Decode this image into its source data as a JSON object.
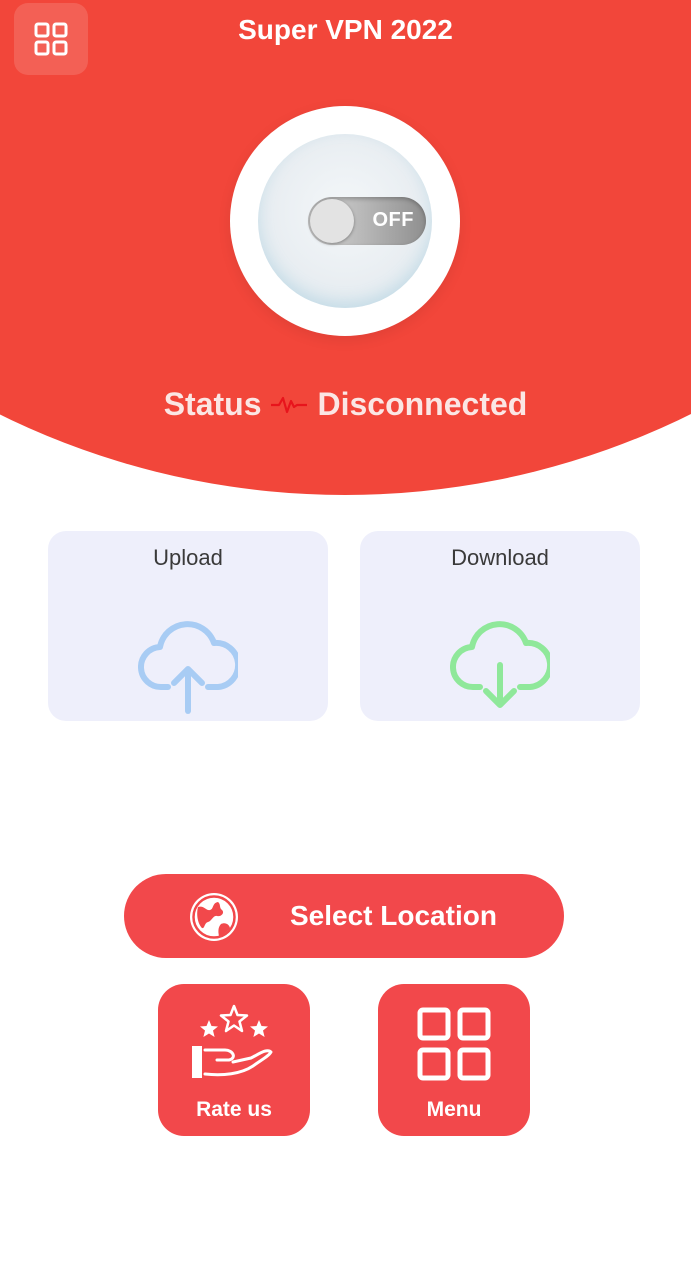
{
  "header": {
    "title": "Super VPN 2022",
    "menu_icon": "grid-icon"
  },
  "power": {
    "toggle_label": "OFF",
    "state": "off"
  },
  "status": {
    "label": "Status",
    "value": "Disconnected",
    "icon": "pulse-icon"
  },
  "stats": {
    "upload_label": "Upload",
    "download_label": "Download"
  },
  "location": {
    "label": "Select Location",
    "icon": "globe-icon"
  },
  "actions": {
    "rate_label": "Rate us",
    "menu_label": "Menu"
  },
  "colors": {
    "primary": "#f2463a",
    "button": "#f2484b",
    "card_bg": "#eeeffb",
    "upload_icon": "#a8ccf4",
    "download_icon": "#8fe89a"
  }
}
